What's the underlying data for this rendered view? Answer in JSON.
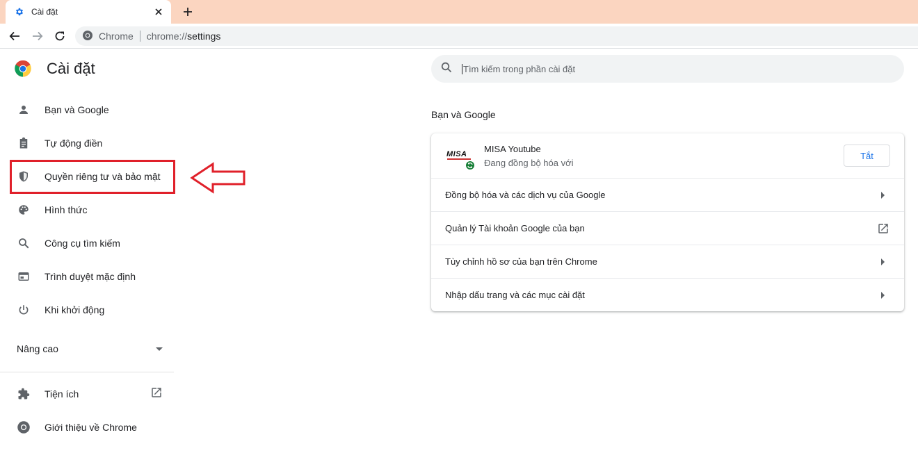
{
  "tab": {
    "title": "Cài đặt",
    "favicon": "gear-icon"
  },
  "omnibox": {
    "site_label": "Chrome",
    "url_scheme": "chrome://",
    "url_path": "settings"
  },
  "header": {
    "title": "Cài đặt"
  },
  "search": {
    "placeholder": "Tìm kiếm trong phần cài đặt"
  },
  "sidebar": {
    "items": [
      {
        "label": "Bạn và Google",
        "icon": "person-icon"
      },
      {
        "label": "Tự động điền",
        "icon": "clipboard-icon"
      },
      {
        "label": "Quyền riêng tư và bảo mật",
        "icon": "shield-icon"
      },
      {
        "label": "Hình thức",
        "icon": "palette-icon"
      },
      {
        "label": "Công cụ tìm kiếm",
        "icon": "search-icon"
      },
      {
        "label": "Trình duyệt mặc định",
        "icon": "browser-window-icon"
      },
      {
        "label": "Khi khởi động",
        "icon": "power-icon"
      }
    ],
    "advanced_label": "Nâng cao",
    "extensions_label": "Tiện ích",
    "about_label": "Giới thiệu về Chrome"
  },
  "section": {
    "title": "Bạn và Google",
    "profile": {
      "name": "MISA Youtube",
      "status": "Đang đồng bộ hóa với",
      "button_label": "Tắt",
      "avatar_text": "MISA"
    },
    "rows": [
      {
        "label": "Đồng bộ hóa và các dịch vụ của Google",
        "trail": "arrow-right-icon"
      },
      {
        "label": "Quản lý Tài khoản Google của bạn",
        "trail": "open-in-new-icon"
      },
      {
        "label": "Tùy chỉnh hồ sơ của bạn trên Chrome",
        "trail": "arrow-right-icon"
      },
      {
        "label": "Nhập dấu trang và các mục cài đặt",
        "trail": "arrow-right-icon"
      }
    ]
  },
  "colors": {
    "accent": "#1a73e8",
    "tabstrip": "#fbd5c0",
    "highlight": "#e0202a"
  }
}
